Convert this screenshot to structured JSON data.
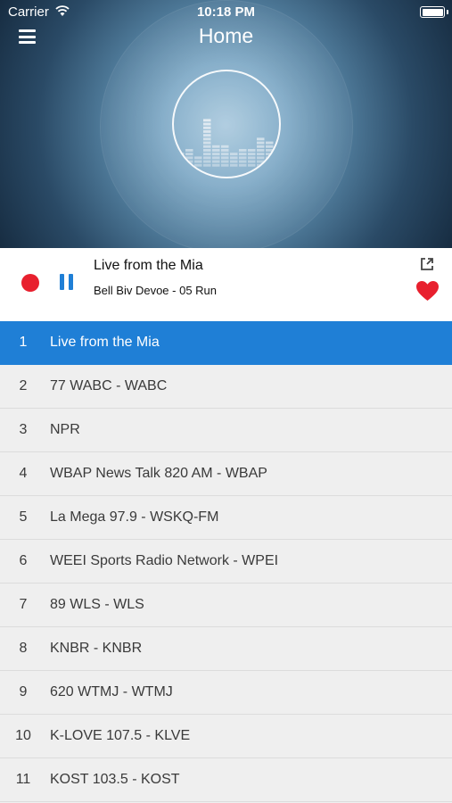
{
  "status_bar": {
    "carrier": "Carrier",
    "time": "10:18 PM"
  },
  "nav": {
    "title": "Home"
  },
  "now_playing": {
    "station": "Live from the Mia",
    "track": "Bell Biv Devoe - 05 Run"
  },
  "colors": {
    "accent": "#1f7fd6",
    "record": "#e8202e",
    "heart": "#e8202e",
    "list_bg": "#efefef"
  },
  "icons": [
    "menu-icon",
    "wifi-icon",
    "battery-icon",
    "record-icon",
    "pause-icon",
    "share-icon",
    "heart-icon"
  ],
  "stations": [
    {
      "num": "1",
      "name": "Live from the Mia",
      "active": true
    },
    {
      "num": "2",
      "name": "77 WABC - WABC"
    },
    {
      "num": "3",
      "name": "NPR"
    },
    {
      "num": "4",
      "name": "WBAP News Talk 820 AM - WBAP"
    },
    {
      "num": "5",
      "name": "La Mega 97.9 - WSKQ-FM"
    },
    {
      "num": "6",
      "name": "WEEI Sports Radio Network - WPEI"
    },
    {
      "num": "7",
      "name": "89 WLS - WLS"
    },
    {
      "num": "8",
      "name": "KNBR - KNBR"
    },
    {
      "num": "9",
      "name": "620 WTMJ - WTMJ"
    },
    {
      "num": "10",
      "name": "K-LOVE 107.5 - KLVE"
    },
    {
      "num": "11",
      "name": "KOST 103.5 - KOST"
    }
  ]
}
